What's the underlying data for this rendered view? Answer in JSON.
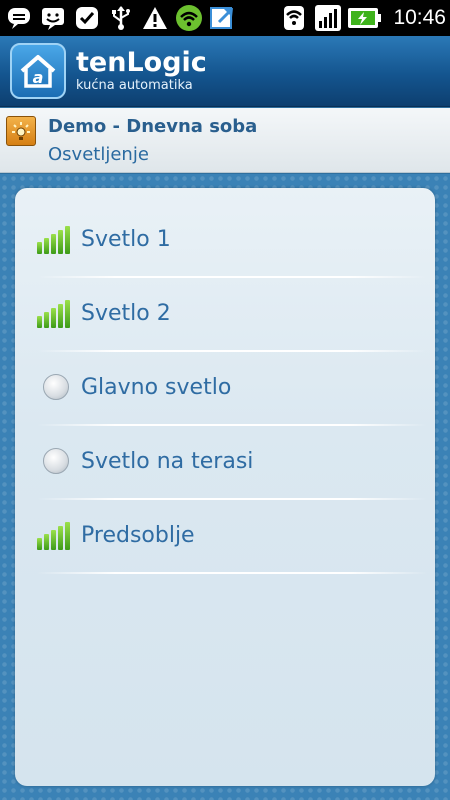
{
  "status_bar": {
    "time": "10:46"
  },
  "app": {
    "title": "tenLogic",
    "subtitle": "kućna automatika"
  },
  "breadcrumb": {
    "location": "Demo - Dnevna soba",
    "category": "Osvetljenje"
  },
  "devices": [
    {
      "label": "Svetlo 1",
      "state": "dimmer-on"
    },
    {
      "label": "Svetlo 2",
      "state": "dimmer-on"
    },
    {
      "label": "Glavno svetlo",
      "state": "off"
    },
    {
      "label": "Svetlo na terasi",
      "state": "off"
    },
    {
      "label": "Predsoblje",
      "state": "dimmer-on"
    }
  ],
  "colors": {
    "accent": "#2f6ca3",
    "header": "#14558f",
    "signal": "#6cc02f"
  }
}
